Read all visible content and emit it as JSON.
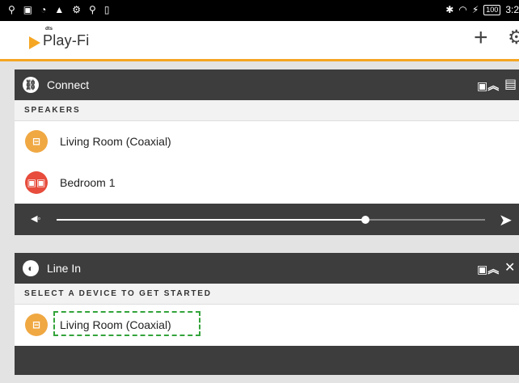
{
  "status_bar": {
    "left_icons": [
      "usb-icon",
      "image-icon",
      "wifi-icon",
      "warning-icon",
      "settings-icon",
      "usb-icon",
      "sd-card-icon"
    ],
    "battery": "100",
    "time": "3:2"
  },
  "app_bar": {
    "brand_top": "dts",
    "brand": "Play-Fi",
    "add_icon": "plus-icon",
    "settings_icon": "gear-icon"
  },
  "connect_card": {
    "title": "Connect",
    "section_label": "SPEAKERS",
    "speakers": [
      {
        "label": "Living Room (Coaxial)",
        "icon_color": "#f0a843"
      },
      {
        "label": "Bedroom 1",
        "icon_color": "#e74c3c"
      }
    ],
    "volume_level": 0.72
  },
  "linein_card": {
    "title": "Line In",
    "section_label": "SELECT A DEVICE TO GET STARTED",
    "devices": [
      {
        "label": "Living Room (Coaxial)",
        "icon_color": "#f0a843"
      }
    ]
  },
  "colors": {
    "accent": "#f5a623",
    "header_bg": "#3d3d3d",
    "highlight": "#33a33a"
  }
}
